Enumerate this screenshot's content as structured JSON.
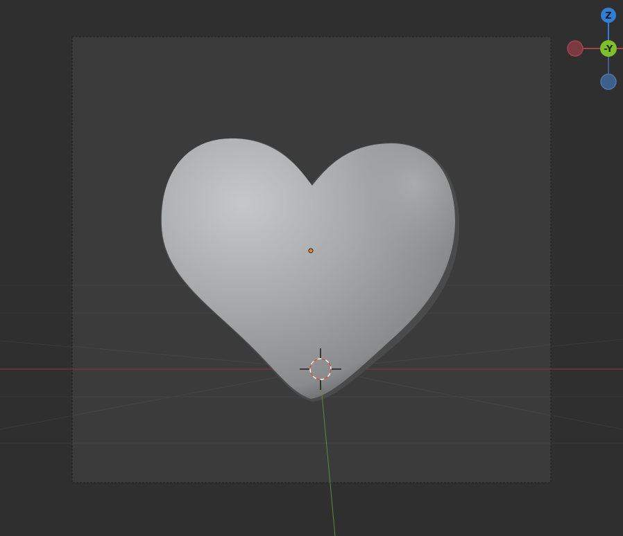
{
  "viewport": {
    "background": "#2f2f2f",
    "camera_frame_fill": "#3b3b3b",
    "x_axis_color": "#a23a44",
    "y_axis_color": "#5f8a3a"
  },
  "gizmo": {
    "z_label": "Z",
    "neg_y_label": "-Y",
    "z_color": "#2f7fd3",
    "neg_y_color": "#7ec02a",
    "neg_x_color": "#a3444f",
    "neg_z_color": "#3d5f8c"
  },
  "object": {
    "shape": "heart",
    "origin_color": "#e58a2b",
    "surface_color": "#a7a8aa"
  },
  "cursor": {
    "ring_colors": [
      "#c94a3d",
      "#ffffff"
    ]
  }
}
